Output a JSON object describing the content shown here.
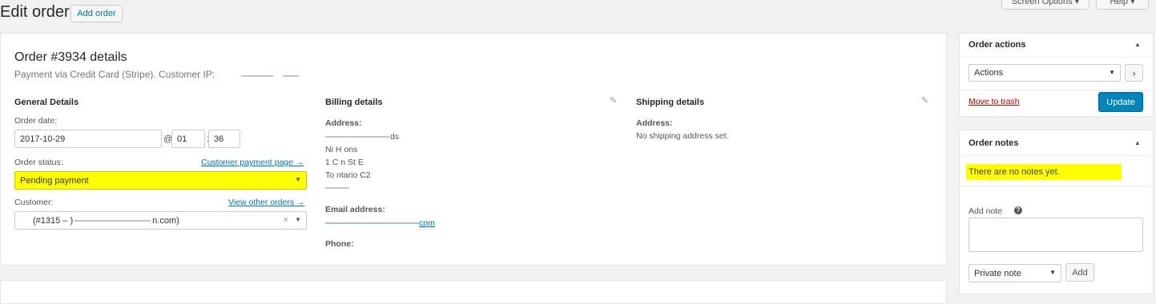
{
  "header": {
    "title": "Edit order",
    "add_button": "Add order",
    "screen_options": "Screen Options ▾",
    "help": "Help ▾"
  },
  "order": {
    "title": "Order #3934 details",
    "subtitle": "Payment via Credit Card (Stripe). Customer IP:",
    "general": {
      "heading": "General Details",
      "date_label": "Order date:",
      "date_value": "2017-10-29",
      "at": "@",
      "hour": "01",
      "colon": ":",
      "minute": "36",
      "status_label": "Order status:",
      "status_link": "Customer payment page →",
      "status_value": "Pending payment",
      "customer_label": "Customer:",
      "customer_link": "View other orders →",
      "customer_value": "(#1315 – )",
      "customer_email_tail": "n.com)"
    },
    "billing": {
      "heading": "Billing details",
      "address_label": "Address:",
      "addr_l1": "ds",
      "addr_l2": "Ni    H  ons",
      "addr_l3": "1     C    n St E",
      "addr_l4": "To      ntario   C2",
      "email_label": "Email address:",
      "email_tail": "com",
      "phone_label": "Phone:"
    },
    "shipping": {
      "heading": "Shipping details",
      "address_label": "Address:",
      "address_value": "No shipping address set."
    }
  },
  "actions": {
    "heading": "Order actions",
    "select_value": "Actions",
    "go": "›",
    "trash": "Move to trash",
    "update": "Update"
  },
  "notes": {
    "heading": "Order notes",
    "empty": "There are no notes yet.",
    "add_label": "Add note",
    "type_value": "Private note",
    "add_button": "Add"
  },
  "colors": {
    "highlight": "#ffff00",
    "primary": "#0085ba",
    "link": "#0073aa",
    "trash": "#a00"
  }
}
